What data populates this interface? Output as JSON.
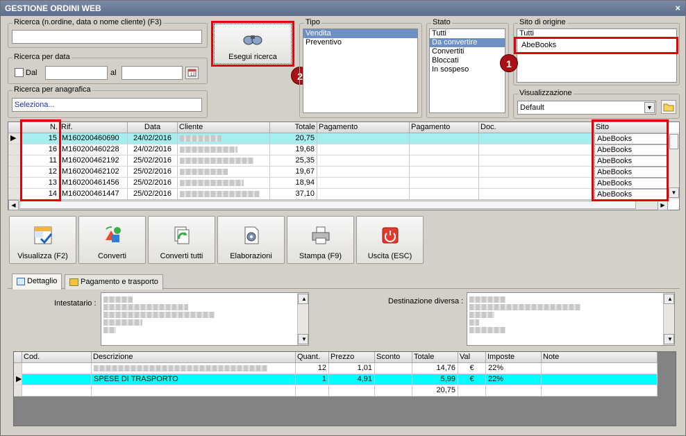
{
  "window": {
    "title": "GESTIONE ORDINI WEB",
    "close_glyph": "×"
  },
  "search": {
    "group_label": "Ricerca (n.ordine, data o nome cliente) (F3)",
    "value": "",
    "date_group_label": "Ricerca per data",
    "dal_label": "Dal",
    "al_label": "al",
    "anag_group_label": "Ricerca per anagrafica",
    "anag_value": "Seleziona...",
    "button_label": "Esegui ricerca"
  },
  "tipo": {
    "label": "Tipo",
    "items": [
      "Vendita",
      "Preventivo"
    ],
    "selected": "Vendita"
  },
  "stato": {
    "label": "Stato",
    "items": [
      "Tutti",
      "Da convertire",
      "Convertiti",
      "Bloccati",
      "In sospeso"
    ],
    "selected": "Da convertire"
  },
  "sito": {
    "label": "Sito di origine",
    "items": [
      "Tutti",
      "AbeBooks"
    ],
    "selected": "AbeBooks"
  },
  "visualizzazione": {
    "label": "Visualizzazione",
    "value": "Default"
  },
  "badges": [
    "1",
    "2"
  ],
  "orders": {
    "columns": [
      "N.",
      "Rif.",
      "Data",
      "Cliente",
      "Totale",
      "Pagamento",
      "Pagamento",
      "Doc.",
      "Sito"
    ],
    "rows": [
      {
        "n": "15",
        "rif": "M160200460690",
        "data": "24/02/2016",
        "totale": "20,75",
        "sito": "AbeBooks"
      },
      {
        "n": "16",
        "rif": "M160200460228",
        "data": "24/02/2016",
        "totale": "19,68",
        "sito": "AbeBooks"
      },
      {
        "n": "11",
        "rif": "M160200462192",
        "data": "25/02/2016",
        "totale": "25,35",
        "sito": "AbeBooks"
      },
      {
        "n": "12",
        "rif": "M160200462102",
        "data": "25/02/2016",
        "totale": "19,67",
        "sito": "AbeBooks"
      },
      {
        "n": "13",
        "rif": "M160200461456",
        "data": "25/02/2016",
        "totale": "18,94",
        "sito": "AbeBooks"
      },
      {
        "n": "14",
        "rif": "M160200461447",
        "data": "25/02/2016",
        "totale": "37,10",
        "sito": "AbeBooks"
      }
    ]
  },
  "toolbar": {
    "visualizza": "Visualizza (F2)",
    "converti": "Converti",
    "converti_tutti": "Converti tutti",
    "elaborazioni": "Elaborazioni",
    "stampa": "Stampa (F9)",
    "uscita": "Uscita (ESC)"
  },
  "tabs": {
    "dettaglio": "Dettaglio",
    "pagamento": "Pagamento e trasporto"
  },
  "detail": {
    "intestatario_label": "Intestatario :",
    "destinazione_label": "Destinazione diversa :"
  },
  "lines": {
    "columns": [
      "Cod.",
      "Descrizione",
      "Quant.",
      "Prezzo",
      "Sconto",
      "Totale",
      "Val",
      "Imposte",
      "Note"
    ],
    "rows": [
      {
        "descrizione": "",
        "quant": "12",
        "prezzo": "1,01",
        "totale": "14,76",
        "val": "€",
        "imposte": "22%"
      },
      {
        "descrizione": "SPESE DI TRASPORTO",
        "quant": "1",
        "prezzo": "4,91",
        "totale": "5,99",
        "val": "€",
        "imposte": "22%"
      }
    ],
    "sum": "20,75"
  },
  "colors": {
    "selected_row": "#a6eef0",
    "highlight_row": "#00ffff",
    "annotation_red": "#e3000b",
    "badge": "#a90f14"
  }
}
